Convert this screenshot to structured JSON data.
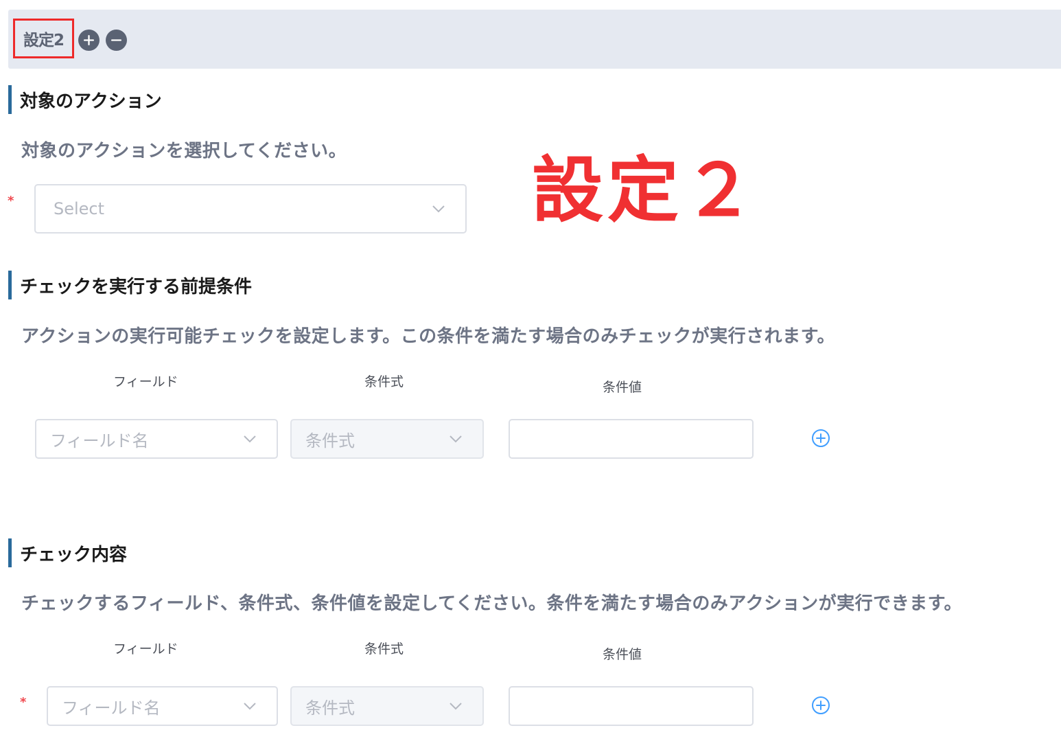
{
  "header": {
    "setting_label": "設定2",
    "add_symbol": "+",
    "remove_symbol": "−"
  },
  "annotation": {
    "text": "設定２",
    "color": "#f03032"
  },
  "target_action": {
    "title": "対象のアクション",
    "description": "対象のアクションを選択してください。",
    "required_mark": "*",
    "select_placeholder": "Select"
  },
  "precondition": {
    "title": "チェックを実行する前提条件",
    "description": "アクションの実行可能チェックを設定します。この条件を満たす場合のみチェックが実行されます。",
    "columns": {
      "field": "フィールド",
      "operator": "条件式",
      "value": "条件値"
    },
    "row": {
      "field_placeholder": "フィールド名",
      "operator_placeholder": "条件式",
      "value": ""
    }
  },
  "check_content": {
    "title": "チェック内容",
    "description": "チェックするフィールド、条件式、条件値を設定してください。条件を満たす場合のみアクションが実行できます。",
    "columns": {
      "field": "フィールド",
      "operator": "条件式",
      "value": "条件値"
    },
    "required_mark": "*",
    "row": {
      "field_placeholder": "フィールド名",
      "operator_placeholder": "条件式",
      "value": ""
    }
  },
  "colors": {
    "accent_bar": "#2a6a9b",
    "header_bg": "#e5e9f1",
    "add_icon": "#409eff",
    "required": "#f0484e"
  },
  "icons": {
    "add_setting": "plus-circle-filled-icon",
    "remove_setting": "minus-circle-filled-icon",
    "dropdown": "chevron-down-icon",
    "add_row": "plus-circle-outline-icon"
  }
}
